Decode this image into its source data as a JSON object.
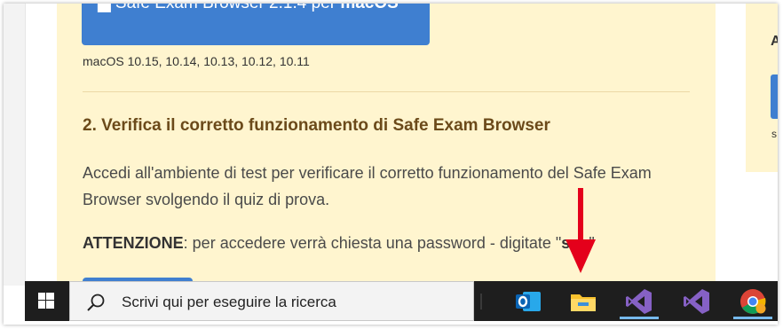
{
  "download": {
    "label_prefix": "Safe Exam Browser 2.1.4 per ",
    "label_os": "macOS",
    "os_versions": "macOS 10.15, 10.14, 10.13, 10.12, 10.11"
  },
  "step2": {
    "title": "2. Verifica il corretto funzionamento di Safe Exam Browser",
    "description": "Accedi all'ambiente di test per verificare il corretto funzionamento del Safe Exam Browser svolgendo il quiz di prova.",
    "warning_label": "ATTENZIONE",
    "warning_text": ": per accedere verrà chiesta una password - digitate \"",
    "password": "seb",
    "warning_end": "\""
  },
  "sidebar": {
    "letter": "A",
    "small": "s"
  },
  "taskbar": {
    "search_placeholder": "Scrivi qui per eseguire la ricerca",
    "apps": [
      "outlook-icon",
      "file-explorer-icon",
      "visual-studio-icon",
      "visual-studio-icon",
      "chrome-icon"
    ]
  },
  "colors": {
    "card_bg": "#fff5cf",
    "button_blue": "#3f7fd0",
    "title_brown": "#6b4a1a",
    "arrow_red": "#e4001b",
    "taskbar_bg": "#1e1e1e"
  }
}
